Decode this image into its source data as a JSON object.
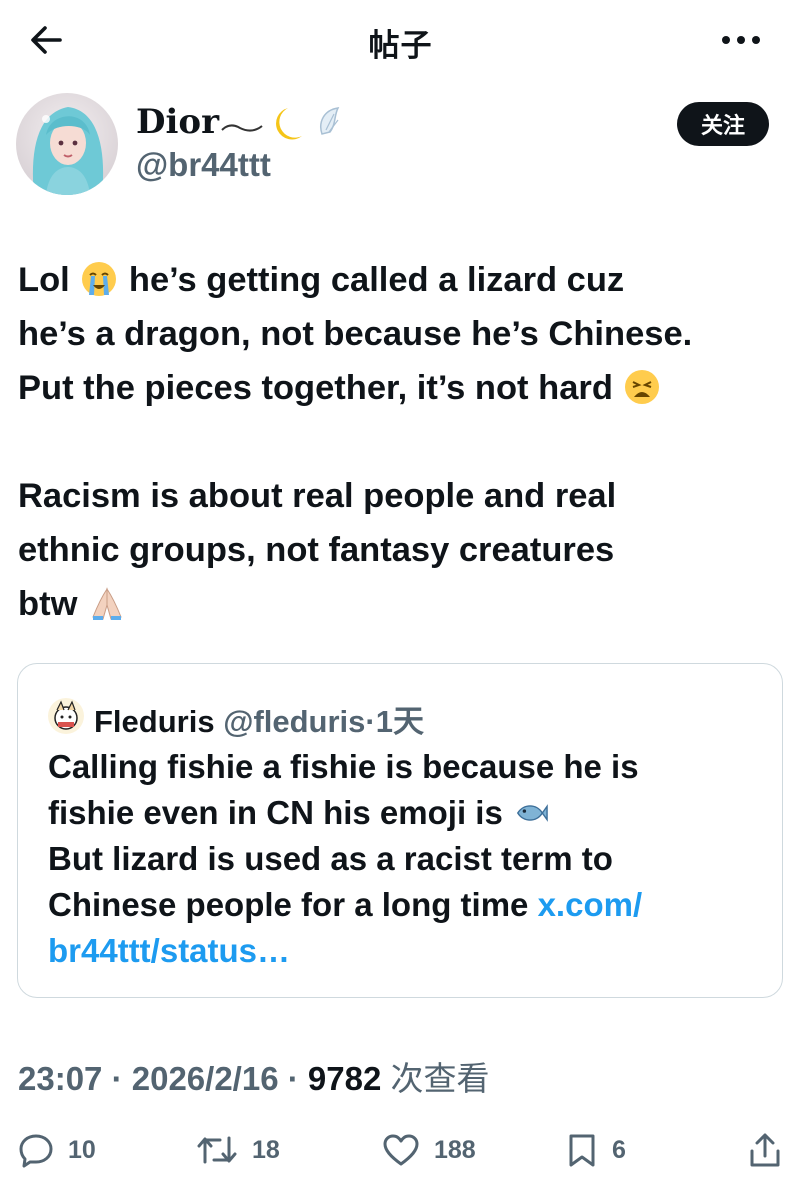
{
  "topbar": {
    "title": "帖子"
  },
  "author": {
    "display_name": "Dior",
    "handle": "@br44ttt",
    "follow_label": "关注"
  },
  "post": {
    "para1": [
      "Lol",
      "he’s getting called a lizard cuz",
      "he’s a dragon, not because he’s Chinese.",
      "Put the pieces together, it’s not hard"
    ],
    "para2": [
      "Racism is about real people and real",
      "ethnic groups, not fantasy creatures",
      "btw"
    ]
  },
  "quote": {
    "name": "Fleduris",
    "handle": "@fleduris",
    "sep": "·",
    "age": "1天",
    "lines": [
      "Calling fishie a fishie is because he is",
      "fishie even in CN his emoji is",
      "But lizard is used as a racist term to",
      "Chinese people for a long time"
    ],
    "link_part1": "x.com/",
    "link_part2": "br44ttt/status…"
  },
  "meta": {
    "time": "23:07",
    "sep": "·",
    "date": "2026/2/16",
    "views": "9782",
    "views_label": "次查看"
  },
  "actions": {
    "replies": "10",
    "reposts": "18",
    "likes": "188",
    "bookmarks": "6"
  },
  "icons": [
    "back-arrow-icon",
    "more-icon",
    "loudly-crying-emoji-icon",
    "weary-face-emoji-icon",
    "folded-hands-emoji-icon",
    "fish-emoji-icon",
    "reply-icon",
    "repost-icon",
    "like-icon",
    "bookmark-icon",
    "share-icon"
  ]
}
